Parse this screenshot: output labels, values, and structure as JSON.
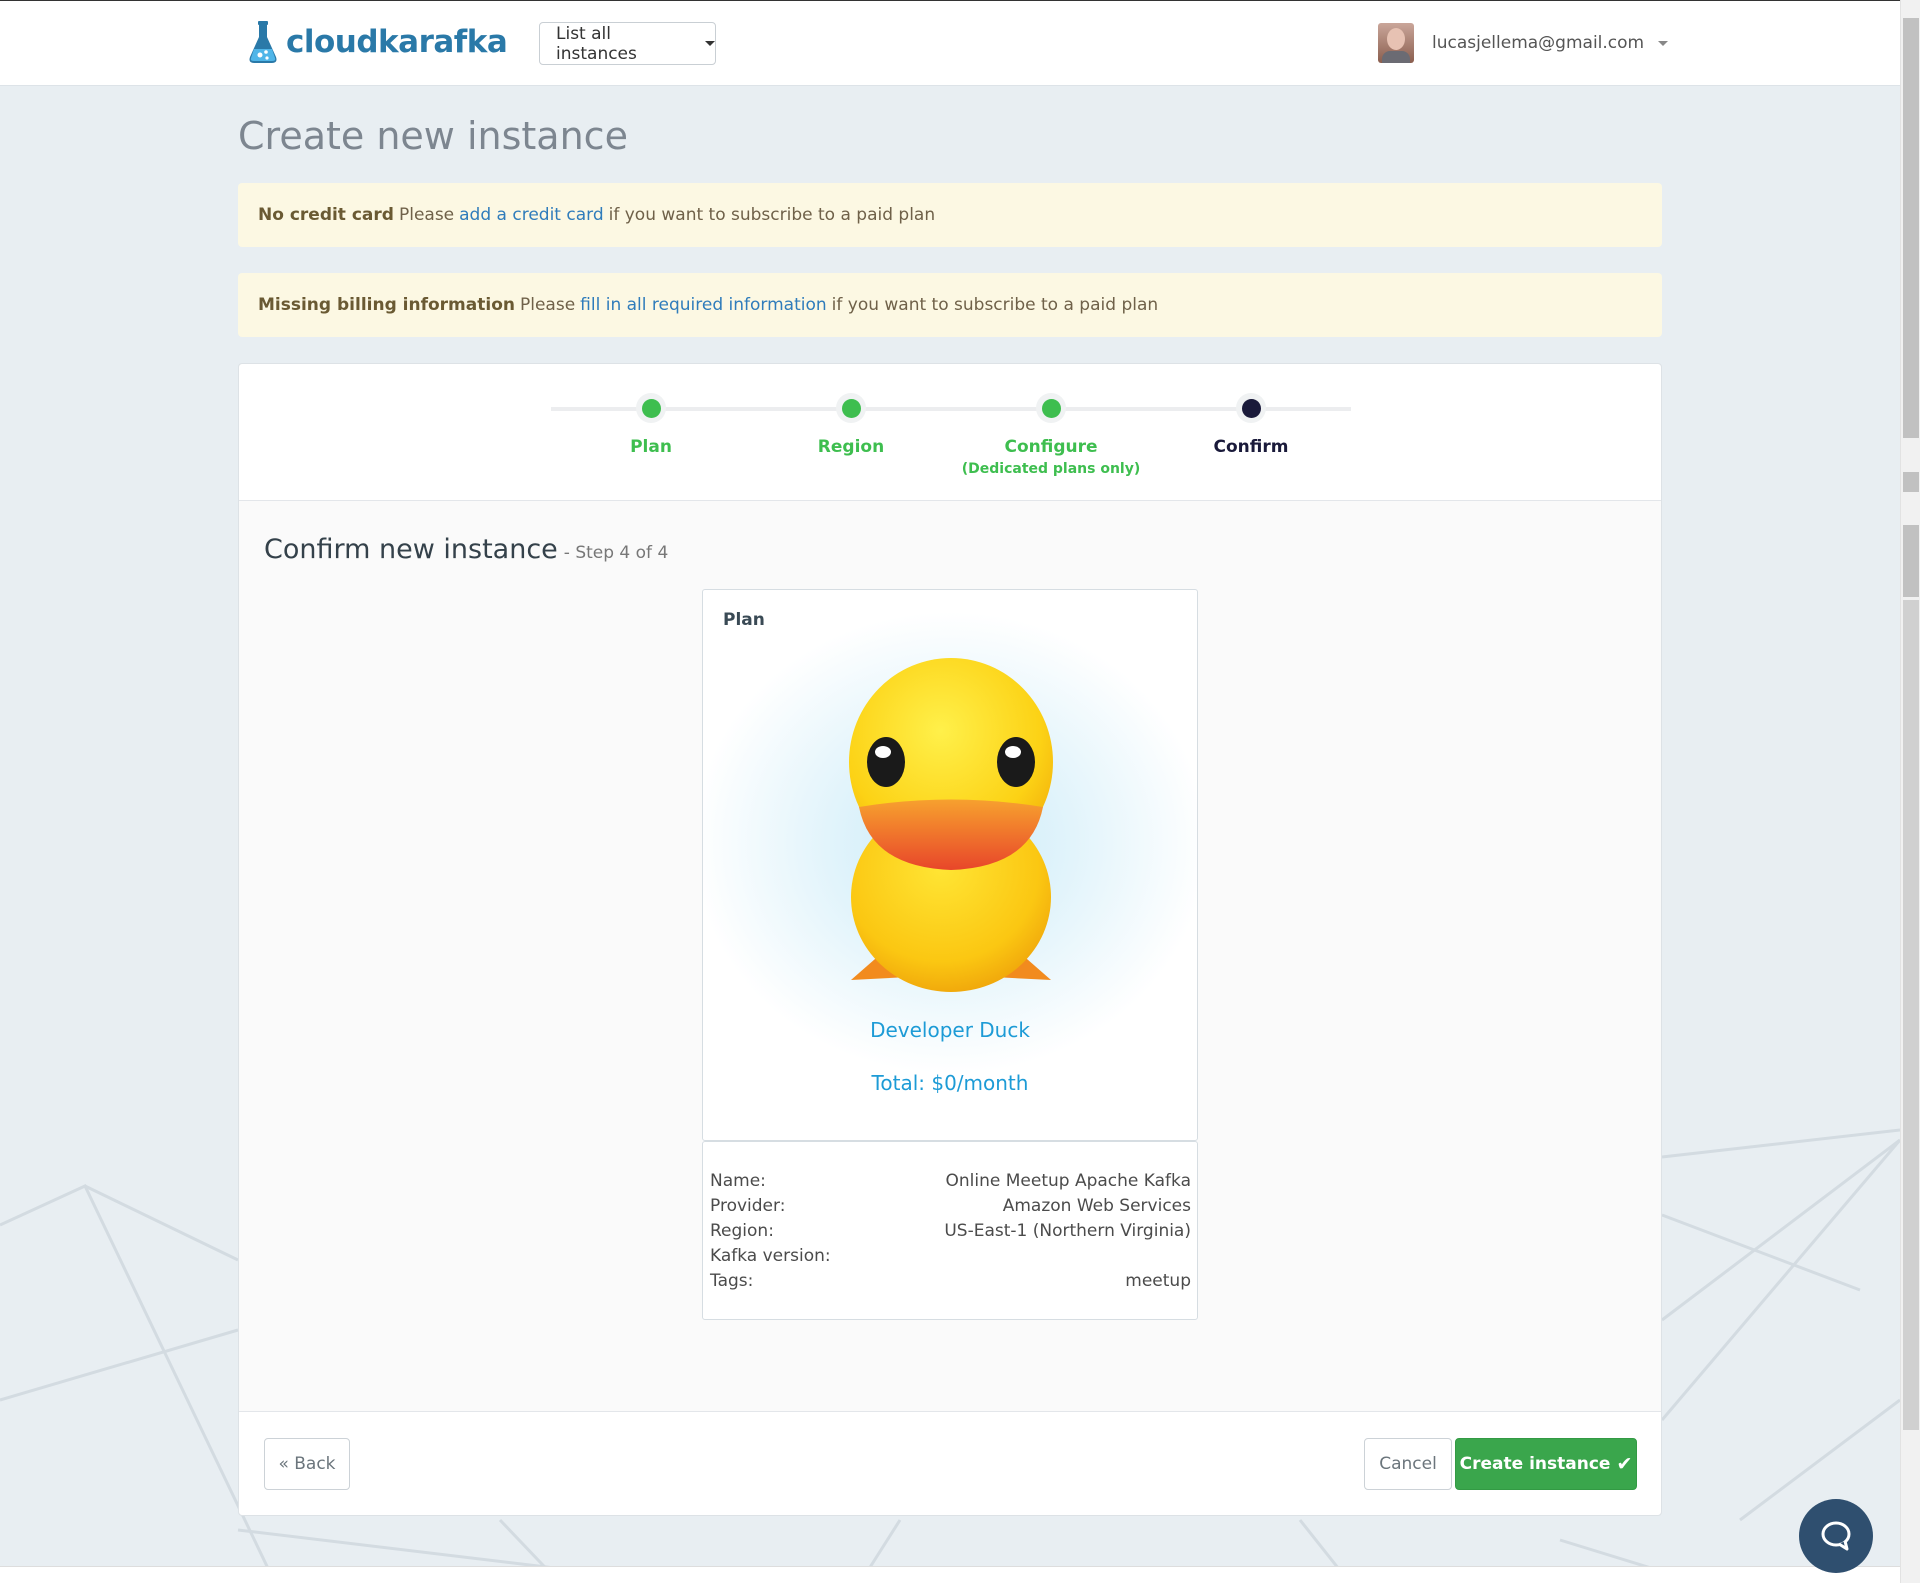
{
  "nav": {
    "logo_text": "cloudkarafka",
    "instances_select": "List all instances",
    "user_email": "lucasjellema@gmail.com"
  },
  "page_title": "Create new instance",
  "alerts": [
    {
      "strong": "No credit card",
      "pre": "Please",
      "link": "add a credit card",
      "post": "if you want to subscribe to a paid plan"
    },
    {
      "strong": "Missing billing information",
      "pre": "Please",
      "link": "fill in all required information",
      "post": "if you want to subscribe to a paid plan"
    }
  ],
  "steps": [
    {
      "label": "Plan",
      "sub": "",
      "state": "done"
    },
    {
      "label": "Region",
      "sub": "",
      "state": "done"
    },
    {
      "label": "Configure",
      "sub": "(Dedicated plans only)",
      "state": "done"
    },
    {
      "label": "Confirm",
      "sub": "",
      "state": "current"
    }
  ],
  "confirm": {
    "heading": "Confirm new instance",
    "step_text": "- Step 4 of 4",
    "plan_label": "Plan",
    "plan_name": "Developer Duck",
    "total": "Total: $0/month",
    "details": [
      {
        "label": "Name:",
        "value": "Online Meetup Apache Kafka"
      },
      {
        "label": "Provider:",
        "value": "Amazon Web Services"
      },
      {
        "label": "Region:",
        "value": "US-East-1 (Northern Virginia)"
      },
      {
        "label": "Kafka version:",
        "value": ""
      },
      {
        "label": "Tags:",
        "value": "meetup"
      }
    ]
  },
  "buttons": {
    "back": "« Back",
    "cancel": "Cancel",
    "create": "Create instance"
  },
  "colors": {
    "accent_green": "#3ebe4f",
    "current_step": "#1a1a3a",
    "plan_blue": "#1d9bd6",
    "logo_blue": "#2a79a8",
    "alert_bg": "#fcf8e3"
  }
}
